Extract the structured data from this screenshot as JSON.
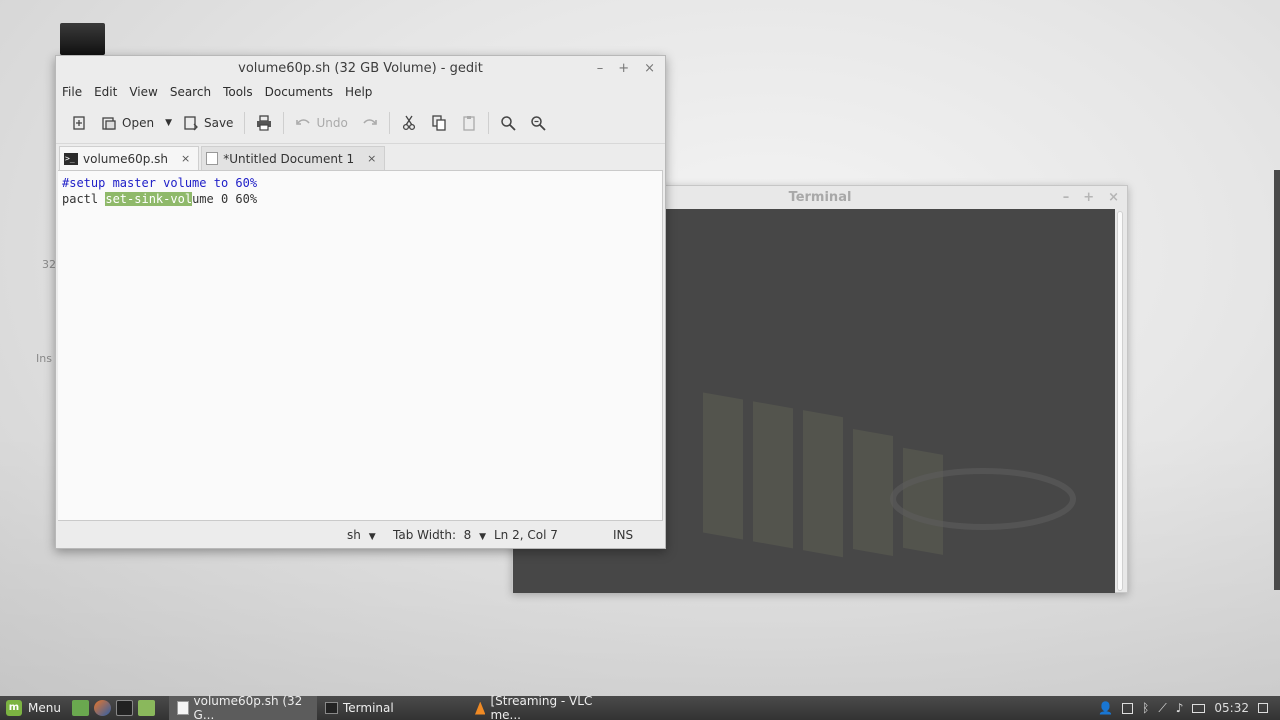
{
  "desktop": {
    "label1": "32",
    "label2": "Ins"
  },
  "terminal_window": {
    "title": "Terminal",
    "controls": [
      "–",
      "+",
      "×"
    ]
  },
  "gedit": {
    "title": "volume60p.sh (32 GB Volume) - gedit",
    "controls": [
      "–",
      "+",
      "×"
    ],
    "menu": [
      "File",
      "Edit",
      "View",
      "Search",
      "Tools",
      "Documents",
      "Help"
    ],
    "toolbar": {
      "open_label": "Open",
      "save_label": "Save",
      "undo_label": "Undo"
    },
    "tabs": [
      {
        "label": "volume60p.sh",
        "close": "×"
      },
      {
        "label": "*Untitled Document 1",
        "close": "×"
      }
    ],
    "code": {
      "line1": "#setup master volume to 60%",
      "line2_pre": "pactl ",
      "line2_sel": "set-sink-vol",
      "line2_post": "ume 0 60%"
    },
    "status": {
      "lang": "sh",
      "tab_width": "Tab Width:  8",
      "position": "Ln 2, Col 7",
      "mode": "INS"
    }
  },
  "taskbar": {
    "menu_label": "Menu",
    "tasks": [
      {
        "label": "volume60p.sh (32 G..."
      },
      {
        "label": "Terminal"
      },
      {
        "label": "[Streaming - VLC me..."
      }
    ],
    "clock": "05:32"
  }
}
